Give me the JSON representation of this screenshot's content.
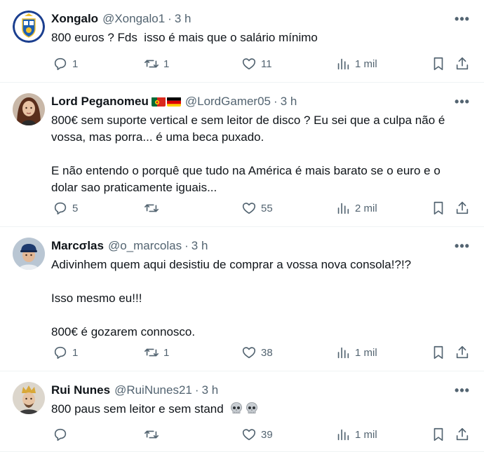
{
  "tweets": [
    {
      "name": "Xongalo",
      "handle": "@Xongalo1",
      "dot": "·",
      "time": "3 h",
      "text": [
        "800 euros ? Fds  isso é mais que o salário mínimo"
      ],
      "replies": "1",
      "retweets": "1",
      "likes": "11",
      "views": "1 mil",
      "avatar": "fc-porto-crest"
    },
    {
      "name": "Lord Peganomeu",
      "flags": [
        "portugal-flag",
        "germany-flag"
      ],
      "handle": "@LordGamer05",
      "dot": "·",
      "time": "3 h",
      "text": [
        "800€ sem suporte vertical e sem leitor de disco ? Eu sei que a culpa não é vossa, mas porra... é uma beca puxado.",
        "E não entendo o porquê que tudo na América é mais barato se o euro e o dolar sao praticamente iguais..."
      ],
      "replies": "5",
      "retweets": "",
      "likes": "55",
      "views": "2 mil",
      "avatar": "woman-portrait"
    },
    {
      "name": "Marcσlas",
      "handle": "@o_marcolas",
      "dot": "·",
      "time": "3 h",
      "text": [
        "Adivinhem quem aqui desistiu de comprar a vossa nova consola!?!?",
        "Isso mesmo eu!!!",
        "800€ é gozarem connosco."
      ],
      "replies": "1",
      "retweets": "1",
      "likes": "38",
      "views": "1 mil",
      "avatar": "man-with-cap"
    },
    {
      "name": "Rui Nunes",
      "handle": "@RuiNunes21",
      "dot": "·",
      "time": "3 h",
      "text": [
        "800 paus sem leitor e sem stand"
      ],
      "emoji": "skull-emoji",
      "replies": "",
      "retweets": "",
      "likes": "39",
      "views": "1 mil",
      "avatar": "man-with-crown"
    }
  ],
  "icons": {
    "reply": "reply-icon",
    "retweet": "retweet-icon",
    "like": "heart-icon",
    "views": "views-icon",
    "bookmark": "bookmark-icon",
    "share": "share-icon",
    "more": "more-icon"
  },
  "colors": {
    "text": "#0f1419",
    "muted": "#536471",
    "divider": "#eff3f4"
  }
}
